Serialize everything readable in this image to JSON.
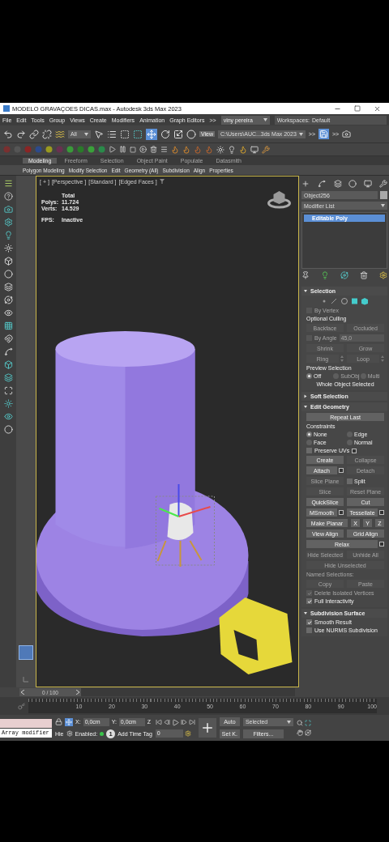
{
  "window": {
    "title": "MODELO GRAVAÇOES DICAS.max - Autodesk 3ds Max 2023"
  },
  "menu": [
    "File",
    "Edit",
    "Tools",
    "Group",
    "Views",
    "Create",
    "Modifiers",
    "Animation",
    "Graph Editors",
    ">>"
  ],
  "user": {
    "name": "viny pereira"
  },
  "workspace": {
    "label": "Workspaces:",
    "value": "Default"
  },
  "toolbar": {
    "filter": "All",
    "view": "View",
    "project_path": "C:\\Users\\AUC...3ds Max 2023",
    "more": ">>",
    "more_2": ">>"
  },
  "ribbon": {
    "tabs": [
      {
        "label": "Modeling",
        "selected": true
      },
      {
        "label": "Freeform",
        "selected": false
      },
      {
        "label": "Selection",
        "selected": false
      },
      {
        "label": "Object Paint",
        "selected": false
      },
      {
        "label": "Populate",
        "selected": false
      },
      {
        "label": "Datasmith",
        "selected": false
      }
    ],
    "panels": [
      "Polygon Modeling",
      "Modify Selection",
      "Edit",
      "Geometry (All)",
      "Subdivision",
      "Align",
      "Properties"
    ]
  },
  "viewport": {
    "labels": [
      "[ + ]",
      "[Perspective ]",
      "[Standard ]",
      "[Edged Faces ]"
    ],
    "active": true,
    "stats": {
      "heading": "Total",
      "rows": [
        {
          "label": "Polys:",
          "value": "11.724"
        },
        {
          "label": "Verts:",
          "value": "14.529"
        }
      ],
      "fps_label": "FPS:",
      "fps_value": "Inactive"
    }
  },
  "command_panel": {
    "object_name": "Object256",
    "modifier_list": "Modifier List",
    "stack": [
      {
        "label": "Editable Poly",
        "selected": true
      }
    ],
    "rollouts": [
      {
        "title": "Selection",
        "expanded": true,
        "items": [
          {
            "kind": "subobjects"
          },
          {
            "kind": "checkbox",
            "label": "By Vertex",
            "checked": false,
            "disabled": true
          },
          {
            "kind": "label",
            "text": "Optional Culling",
            "disabled": false
          },
          {
            "kind": "buttons",
            "buttons": [
              {
                "label": "Backface",
                "disabled": true
              },
              {
                "label": "Occluded",
                "disabled": true
              }
            ]
          },
          {
            "kind": "spinner",
            "label": "By Angle",
            "value": "45,0",
            "checked": false,
            "disabled": true
          },
          {
            "kind": "buttons",
            "buttons": [
              {
                "label": "Shrink",
                "disabled": true
              },
              {
                "label": "Grow",
                "disabled": true
              }
            ]
          },
          {
            "kind": "buttons",
            "buttons": [
              {
                "label": "Ring",
                "disabled": true,
                "spinner": true
              },
              {
                "label": "Loop",
                "disabled": true,
                "spinner": true
              }
            ]
          },
          {
            "kind": "label",
            "text": "Preview Selection",
            "disabled": false
          },
          {
            "kind": "radios",
            "options": [
              {
                "label": "Off",
                "selected": true,
                "disabled": false
              },
              {
                "label": "SubObj",
                "selected": false,
                "disabled": true
              },
              {
                "label": "Multi",
                "selected": false,
                "disabled": true
              }
            ]
          },
          {
            "kind": "text",
            "text": "Whole Object Selected"
          }
        ]
      },
      {
        "title": "Soft Selection",
        "expanded": false
      },
      {
        "title": "Edit Geometry",
        "expanded": true,
        "items": [
          {
            "kind": "buttons",
            "buttons": [
              {
                "label": "Repeat Last",
                "disabled": false
              }
            ]
          },
          {
            "kind": "label",
            "text": "Constraints",
            "disabled": false
          },
          {
            "kind": "radios",
            "options": [
              {
                "label": "None",
                "selected": true,
                "disabled": false
              },
              {
                "label": "Edge",
                "selected": false,
                "disabled": false
              }
            ]
          },
          {
            "kind": "radios",
            "options": [
              {
                "label": "Face",
                "selected": false,
                "disabled": false
              },
              {
                "label": "Normal",
                "selected": false,
                "disabled": false
              }
            ]
          },
          {
            "kind": "checkbox",
            "label": "Preserve UVs",
            "checked": false,
            "disabled": false,
            "settings": true
          },
          {
            "kind": "buttons",
            "buttons": [
              {
                "label": "Create",
                "disabled": false
              },
              {
                "label": "Collapse",
                "disabled": true
              }
            ]
          },
          {
            "kind": "buttons",
            "buttons": [
              {
                "label": "Attach",
                "disabled": false,
                "settings": true
              },
              {
                "label": "Detach",
                "disabled": true
              }
            ]
          },
          {
            "kind": "buttons",
            "buttons": [
              {
                "label": "Slice Plane",
                "disabled": true
              },
              {
                "label": "Split",
                "disabled": false,
                "checked": false
              }
            ]
          },
          {
            "kind": "buttons",
            "buttons": [
              {
                "label": "Slice",
                "disabled": true
              },
              {
                "label": "Reset Plane",
                "disabled": true
              }
            ]
          },
          {
            "kind": "buttons",
            "buttons": [
              {
                "label": "QuickSlice",
                "disabled": false
              },
              {
                "label": "Cut",
                "disabled": false
              }
            ]
          },
          {
            "kind": "buttons",
            "buttons": [
              {
                "label": "MSmooth",
                "disabled": false,
                "settings": true
              },
              {
                "label": "Tessellate",
                "disabled": false,
                "settings": true
              }
            ]
          },
          {
            "kind": "buttons",
            "buttons": [
              {
                "label": "Make Planar",
                "disabled": false
              },
              {
                "label": "X",
                "disabled": false
              },
              {
                "label": "Y",
                "disabled": false
              },
              {
                "label": "Z",
                "disabled": false
              }
            ]
          },
          {
            "kind": "buttons",
            "buttons": [
              {
                "label": "View Align",
                "disabled": false
              },
              {
                "label": "Grid Align",
                "disabled": false
              }
            ]
          },
          {
            "kind": "buttons",
            "buttons": [
              {
                "label": "Relax",
                "disabled": false,
                "settings": true
              }
            ]
          },
          {
            "kind": "buttons",
            "buttons": [
              {
                "label": "Hide Selected",
                "disabled": true
              },
              {
                "label": "Unhide All",
                "disabled": true
              }
            ]
          },
          {
            "kind": "buttons",
            "buttons": [
              {
                "label": "Hide Unselected",
                "disabled": true
              }
            ]
          },
          {
            "kind": "label",
            "text": "Named Selections:",
            "disabled": true
          },
          {
            "kind": "buttons",
            "buttons": [
              {
                "label": "Copy",
                "disabled": true
              },
              {
                "label": "Paste",
                "disabled": true
              }
            ]
          },
          {
            "kind": "checkbox",
            "label": "Delete Isolated Vertices",
            "checked": true,
            "disabled": true
          },
          {
            "kind": "checkbox",
            "label": "Full Interactivity",
            "checked": true,
            "disabled": false
          }
        ]
      },
      {
        "title": "Subdivision Surface",
        "expanded": true,
        "items": [
          {
            "kind": "checkbox",
            "label": "Smooth Result",
            "checked": true,
            "disabled": false
          },
          {
            "kind": "checkbox",
            "label": "Use NURMS Subdivision",
            "checked": false,
            "disabled": false
          }
        ]
      }
    ]
  },
  "timeline": {
    "slider": {
      "label": "0 / 100",
      "level": 0
    },
    "ticks": [
      "10",
      "20",
      "30",
      "40",
      "50",
      "60",
      "70",
      "80",
      "90",
      "100"
    ]
  },
  "status": {
    "listener": "Array modifier",
    "hierarchy": "Hie",
    "enabled": "Enabled:",
    "isolate": "1",
    "add_time_tag": "Add Time Tag",
    "x_label": "X:",
    "x": "0,0cm",
    "y_label": "Y:",
    "y": "0,0cm",
    "z_label": "Z",
    "frame": "0",
    "auto": "Auto",
    "set_key": "Set K.",
    "key_filter": "Selected",
    "filters": "Filters..."
  }
}
